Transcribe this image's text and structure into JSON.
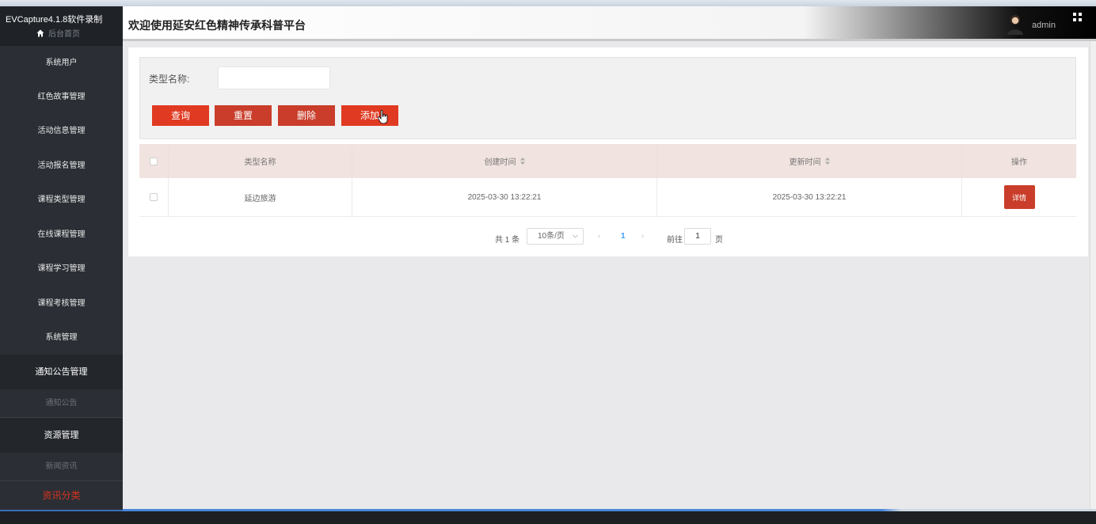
{
  "sidebar": {
    "app_title": "EVCapture4.1.8软件录制",
    "home_label": "后台首页",
    "items": [
      {
        "label": "系统用户"
      },
      {
        "label": "红色故事管理"
      },
      {
        "label": "活动信息管理"
      },
      {
        "label": "活动报名管理"
      },
      {
        "label": "课程类型管理"
      },
      {
        "label": "在线课程管理"
      },
      {
        "label": "课程学习管理"
      },
      {
        "label": "课程考核管理"
      },
      {
        "label": "系统管理"
      },
      {
        "label": "通知公告管理"
      },
      {
        "label": "通知公告"
      },
      {
        "label": "资源管理"
      },
      {
        "label": "新闻资讯"
      },
      {
        "label": "资讯分类"
      }
    ]
  },
  "header": {
    "title": "欢迎使用延安红色精神传承科普平台",
    "user": "admin"
  },
  "search": {
    "label": "类型名称:",
    "value": "",
    "query_label": "查询",
    "reset_label": "重置",
    "delete_label": "删除",
    "add_label": "添加"
  },
  "table": {
    "columns": [
      "类型名称",
      "创建时间",
      "更新时间",
      "操作"
    ],
    "rows": [
      {
        "name": "延边旅游",
        "created": "2025-03-30 13:22:21",
        "updated": "2025-03-30 13:22:21",
        "action": "详情"
      }
    ]
  },
  "pagination": {
    "total": "共 1 条",
    "page_size": "10条/页",
    "current": "1",
    "goto": "前往",
    "goto_value": "1",
    "page_unit": "页"
  },
  "colors": {
    "accent": "#e03a22",
    "sidebar_bg": "#2b2f35",
    "header_row_bg": "#f1e3df",
    "active_menu": "#d9331f"
  },
  "icons": [
    "home-icon",
    "expand-icon",
    "sort-icon",
    "chevron-down-icon",
    "hand-cursor-icon"
  ]
}
